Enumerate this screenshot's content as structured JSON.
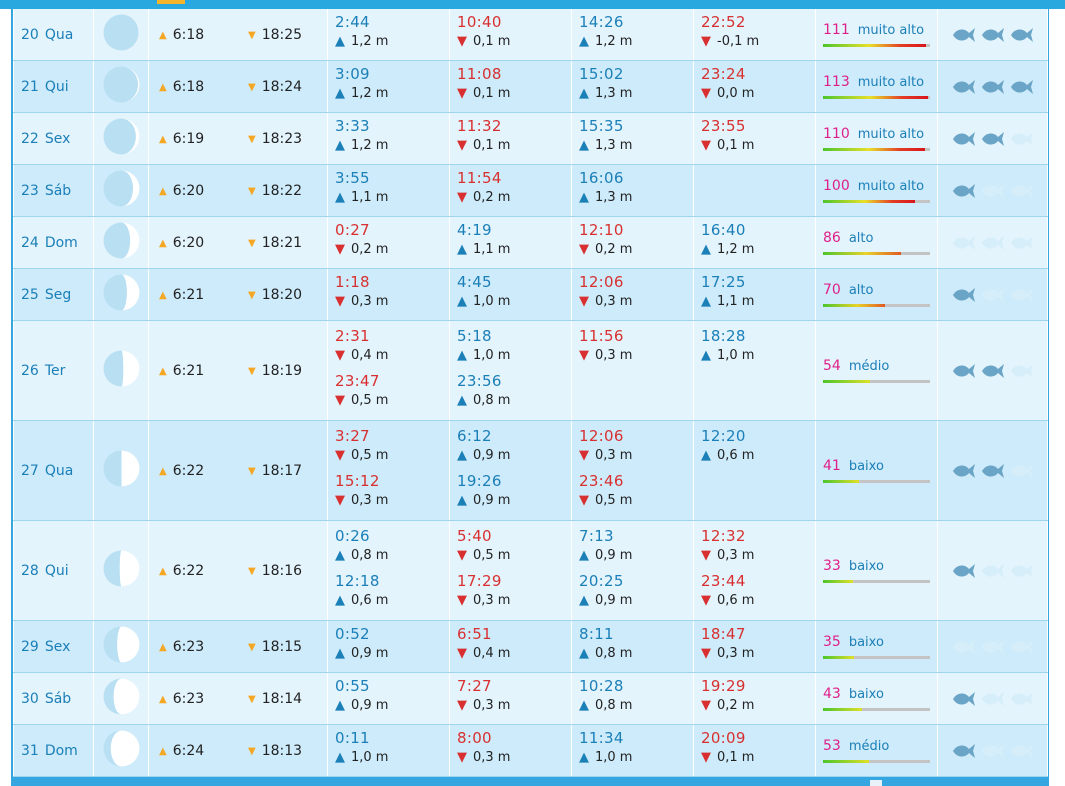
{
  "colors": {
    "header": "#29a8e0",
    "accent": "#f5b429",
    "high_tide": "#1b7fb8",
    "low_tide": "#d83030",
    "coef_number": "#e0208a",
    "fish_active": "#6aa4c6",
    "fish_inactive": "#d6eef9"
  },
  "rows": [
    {
      "day": "20",
      "weekday": "Qua",
      "moon_phase": 0.98,
      "sunrise": "6:18",
      "sunset": "18:25",
      "tides": [
        [
          {
            "time": "2:44",
            "height": "1,2 m",
            "type": "high"
          }
        ],
        [
          {
            "time": "10:40",
            "height": "0,1 m",
            "type": "low"
          }
        ],
        [
          {
            "time": "14:26",
            "height": "1,2 m",
            "type": "high"
          }
        ],
        [
          {
            "time": "22:52",
            "height": "-0,1 m",
            "type": "low"
          }
        ]
      ],
      "coef": "111",
      "coef_label": "muito alto",
      "coef_level": 0.96,
      "fish": 3
    },
    {
      "day": "21",
      "weekday": "Qui",
      "moon_phase": 0.96,
      "sunrise": "6:18",
      "sunset": "18:24",
      "tides": [
        [
          {
            "time": "3:09",
            "height": "1,2 m",
            "type": "high"
          }
        ],
        [
          {
            "time": "11:08",
            "height": "0,1 m",
            "type": "low"
          }
        ],
        [
          {
            "time": "15:02",
            "height": "1,3 m",
            "type": "high"
          }
        ],
        [
          {
            "time": "23:24",
            "height": "0,0 m",
            "type": "low"
          }
        ]
      ],
      "coef": "113",
      "coef_label": "muito alto",
      "coef_level": 0.98,
      "fish": 3
    },
    {
      "day": "22",
      "weekday": "Sex",
      "moon_phase": 0.9,
      "sunrise": "6:19",
      "sunset": "18:23",
      "tides": [
        [
          {
            "time": "3:33",
            "height": "1,2 m",
            "type": "high"
          }
        ],
        [
          {
            "time": "11:32",
            "height": "0,1 m",
            "type": "low"
          }
        ],
        [
          {
            "time": "15:35",
            "height": "1,3 m",
            "type": "high"
          }
        ],
        [
          {
            "time": "23:55",
            "height": "0,1 m",
            "type": "low"
          }
        ]
      ],
      "coef": "110",
      "coef_label": "muito alto",
      "coef_level": 0.95,
      "fish": 2
    },
    {
      "day": "23",
      "weekday": "Sáb",
      "moon_phase": 0.82,
      "sunrise": "6:20",
      "sunset": "18:22",
      "tides": [
        [
          {
            "time": "3:55",
            "height": "1,1 m",
            "type": "high"
          }
        ],
        [
          {
            "time": "11:54",
            "height": "0,2 m",
            "type": "low"
          }
        ],
        [
          {
            "time": "16:06",
            "height": "1,3 m",
            "type": "high"
          }
        ],
        []
      ],
      "coef": "100",
      "coef_label": "muito alto",
      "coef_level": 0.86,
      "fish": 1
    },
    {
      "day": "24",
      "weekday": "Dom",
      "moon_phase": 0.74,
      "sunrise": "6:20",
      "sunset": "18:21",
      "tides": [
        [
          {
            "time": "0:27",
            "height": "0,2 m",
            "type": "low"
          }
        ],
        [
          {
            "time": "4:19",
            "height": "1,1 m",
            "type": "high"
          }
        ],
        [
          {
            "time": "12:10",
            "height": "0,2 m",
            "type": "low"
          }
        ],
        [
          {
            "time": "16:40",
            "height": "1,2 m",
            "type": "high"
          }
        ]
      ],
      "coef": "86",
      "coef_label": "alto",
      "coef_level": 0.73,
      "fish": 0
    },
    {
      "day": "25",
      "weekday": "Seg",
      "moon_phase": 0.65,
      "sunrise": "6:21",
      "sunset": "18:20",
      "tides": [
        [
          {
            "time": "1:18",
            "height": "0,3 m",
            "type": "low"
          }
        ],
        [
          {
            "time": "4:45",
            "height": "1,0 m",
            "type": "high"
          }
        ],
        [
          {
            "time": "12:06",
            "height": "0,3 m",
            "type": "low"
          }
        ],
        [
          {
            "time": "17:25",
            "height": "1,1 m",
            "type": "high"
          }
        ]
      ],
      "coef": "70",
      "coef_label": "alto",
      "coef_level": 0.58,
      "fish": 1
    },
    {
      "day": "26",
      "weekday": "Ter",
      "moon_phase": 0.55,
      "sunrise": "6:21",
      "sunset": "18:19",
      "tides": [
        [
          {
            "time": "2:31",
            "height": "0,4 m",
            "type": "low"
          },
          {
            "time": "23:47",
            "height": "0,5 m",
            "type": "low"
          }
        ],
        [
          {
            "time": "5:18",
            "height": "1,0 m",
            "type": "high"
          },
          {
            "time": "23:56",
            "height": "0,8 m",
            "type": "high"
          }
        ],
        [
          {
            "time": "11:56",
            "height": "0,3 m",
            "type": "low"
          }
        ],
        [
          {
            "time": "18:28",
            "height": "1,0 m",
            "type": "high"
          }
        ]
      ],
      "coef": "54",
      "coef_label": "médio",
      "coef_level": 0.44,
      "fish": 2
    },
    {
      "day": "27",
      "weekday": "Qua",
      "moon_phase": 0.5,
      "sunrise": "6:22",
      "sunset": "18:17",
      "tides": [
        [
          {
            "time": "3:27",
            "height": "0,5 m",
            "type": "low"
          },
          {
            "time": "15:12",
            "height": "0,3 m",
            "type": "low"
          }
        ],
        [
          {
            "time": "6:12",
            "height": "0,9 m",
            "type": "high"
          },
          {
            "time": "19:26",
            "height": "0,9 m",
            "type": "high"
          }
        ],
        [
          {
            "time": "12:06",
            "height": "0,3 m",
            "type": "low"
          },
          {
            "time": "23:46",
            "height": "0,5 m",
            "type": "low"
          }
        ],
        [
          {
            "time": "12:20",
            "height": "0,6 m",
            "type": "high"
          }
        ]
      ],
      "coef": "41",
      "coef_label": "baixo",
      "coef_level": 0.34,
      "fish": 2
    },
    {
      "day": "28",
      "weekday": "Qui",
      "moon_phase": 0.45,
      "sunrise": "6:22",
      "sunset": "18:16",
      "tides": [
        [
          {
            "time": "0:26",
            "height": "0,8 m",
            "type": "high"
          },
          {
            "time": "12:18",
            "height": "0,6 m",
            "type": "high"
          }
        ],
        [
          {
            "time": "5:40",
            "height": "0,5 m",
            "type": "low"
          },
          {
            "time": "17:29",
            "height": "0,3 m",
            "type": "low"
          }
        ],
        [
          {
            "time": "7:13",
            "height": "0,9 m",
            "type": "high"
          },
          {
            "time": "20:25",
            "height": "0,9 m",
            "type": "high"
          }
        ],
        [
          {
            "time": "12:32",
            "height": "0,3 m",
            "type": "low"
          },
          {
            "time": "23:44",
            "height": "0,6 m",
            "type": "low"
          }
        ]
      ],
      "coef": "33",
      "coef_label": "baixo",
      "coef_level": 0.28,
      "fish": 1
    },
    {
      "day": "29",
      "weekday": "Sex",
      "moon_phase": 0.38,
      "sunrise": "6:23",
      "sunset": "18:15",
      "tides": [
        [
          {
            "time": "0:52",
            "height": "0,9 m",
            "type": "high"
          }
        ],
        [
          {
            "time": "6:51",
            "height": "0,4 m",
            "type": "low"
          }
        ],
        [
          {
            "time": "8:11",
            "height": "0,8 m",
            "type": "high"
          }
        ],
        [
          {
            "time": "18:47",
            "height": "0,3 m",
            "type": "low"
          }
        ]
      ],
      "coef": "35",
      "coef_label": "baixo",
      "coef_level": 0.29,
      "fish": 0
    },
    {
      "day": "30",
      "weekday": "Sáb",
      "moon_phase": 0.28,
      "sunrise": "6:23",
      "sunset": "18:14",
      "tides": [
        [
          {
            "time": "0:55",
            "height": "0,9 m",
            "type": "high"
          }
        ],
        [
          {
            "time": "7:27",
            "height": "0,3 m",
            "type": "low"
          }
        ],
        [
          {
            "time": "10:28",
            "height": "0,8 m",
            "type": "high"
          }
        ],
        [
          {
            "time": "19:29",
            "height": "0,2 m",
            "type": "low"
          }
        ]
      ],
      "coef": "43",
      "coef_label": "baixo",
      "coef_level": 0.36,
      "fish": 1
    },
    {
      "day": "31",
      "weekday": "Dom",
      "moon_phase": 0.2,
      "sunrise": "6:24",
      "sunset": "18:13",
      "tides": [
        [
          {
            "time": "0:11",
            "height": "1,0 m",
            "type": "high"
          }
        ],
        [
          {
            "time": "8:00",
            "height": "0,3 m",
            "type": "low"
          }
        ],
        [
          {
            "time": "11:34",
            "height": "1,0 m",
            "type": "high"
          }
        ],
        [
          {
            "time": "20:09",
            "height": "0,1 m",
            "type": "low"
          }
        ]
      ],
      "coef": "53",
      "coef_label": "médio",
      "coef_level": 0.43,
      "fish": 1
    }
  ]
}
